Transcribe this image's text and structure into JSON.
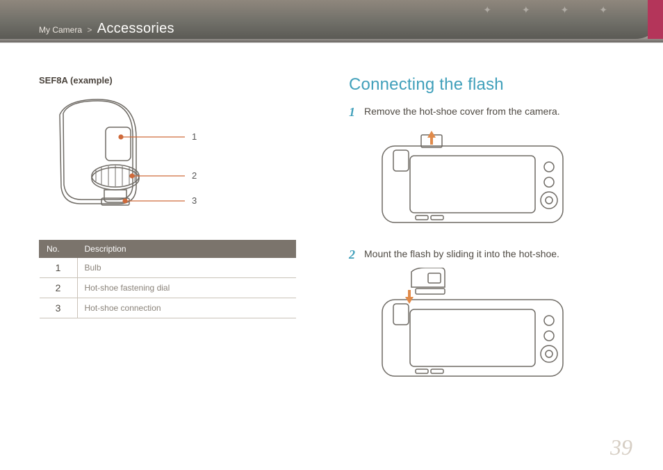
{
  "breadcrumb": {
    "parent": "My Camera",
    "separator": ">",
    "current": "Accessories"
  },
  "left": {
    "example_title": "SEF8A (example)",
    "callouts": [
      "1",
      "2",
      "3"
    ],
    "table": {
      "head_no": "No.",
      "head_desc": "Description",
      "rows": [
        {
          "no": "1",
          "desc": "Bulb"
        },
        {
          "no": "2",
          "desc": "Hot-shoe fastening dial"
        },
        {
          "no": "3",
          "desc": "Hot-shoe connection"
        }
      ]
    }
  },
  "right": {
    "heading": "Connecting the flash",
    "steps": [
      "Remove the hot-shoe cover from the camera.",
      "Mount the flash by sliding it into the hot-shoe."
    ]
  },
  "page_number": "39"
}
